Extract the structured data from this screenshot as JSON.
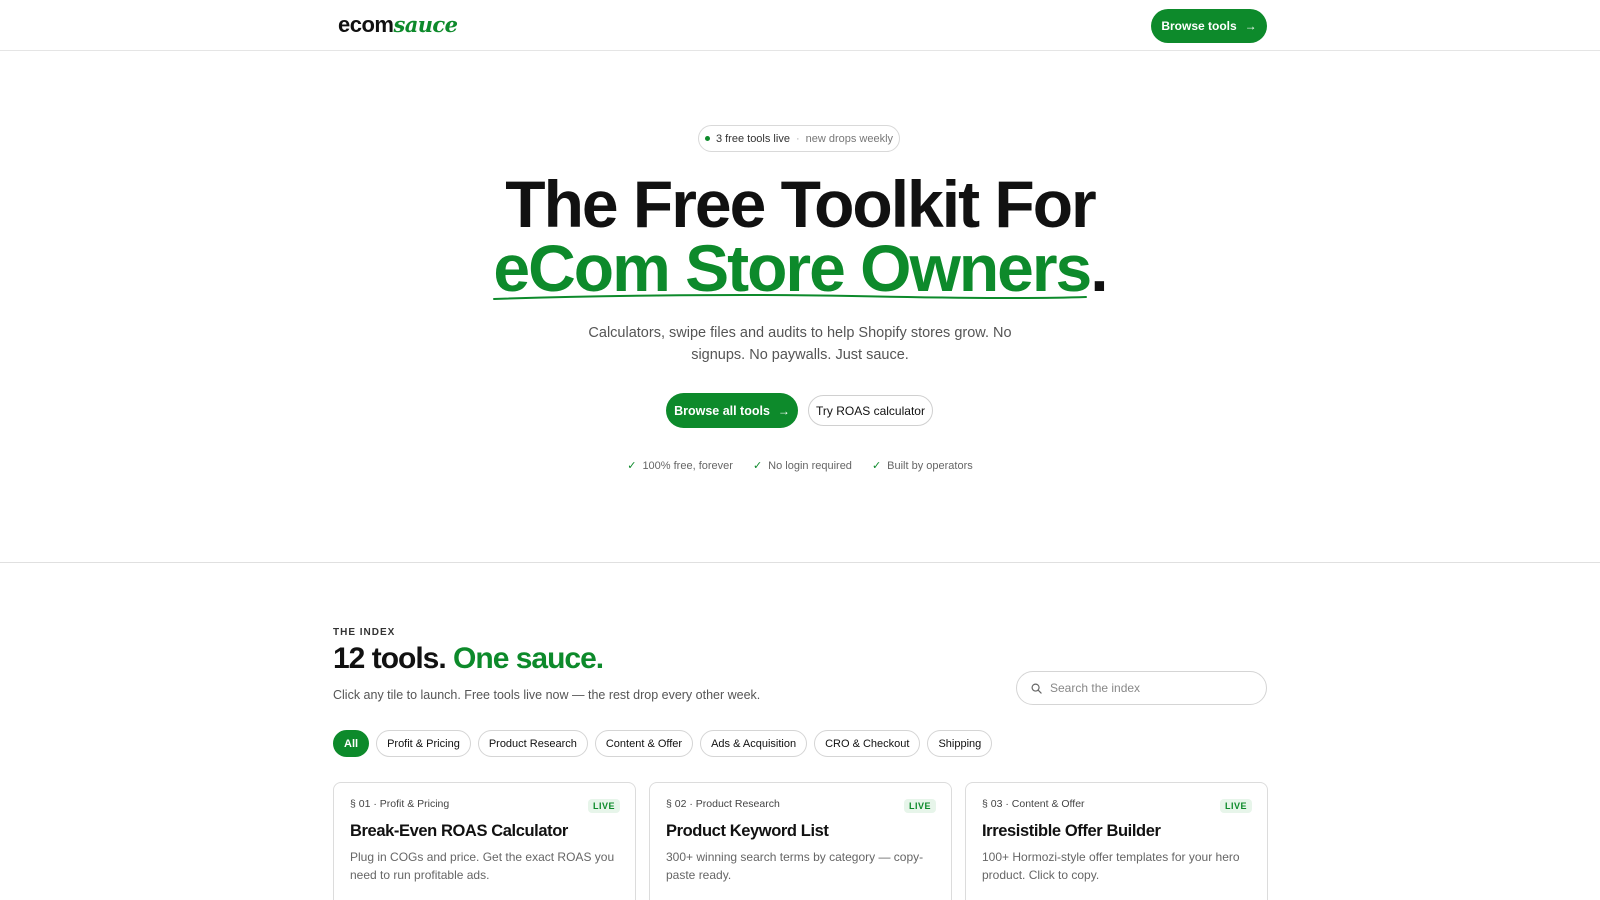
{
  "header": {
    "logo_main": "ecom",
    "logo_script": "sauce",
    "browse_tools_label": "Browse tools",
    "browse_tools_arrow": "→"
  },
  "hero": {
    "pill_live": "3 free tools live",
    "pill_sep": "·",
    "pill_drops": "new drops weekly",
    "title_line1": "The Free Toolkit For",
    "title_line2": "eCom Store Owners",
    "title_period": ".",
    "subtitle": "Calculators, swipe files and audits to help Shopify stores grow. No signups. No paywalls. Just sauce.",
    "primary_cta": "Browse all tools",
    "primary_cta_arrow": "→",
    "secondary_cta": "Try ROAS calculator",
    "checks": [
      "100% free, forever",
      "No login required",
      "Built by operators"
    ]
  },
  "index": {
    "eyebrow": "THE INDEX",
    "title_part1": "12 tools.",
    "title_part2": "One sauce.",
    "description": "Click any tile to launch. Free tools live now — the rest drop every other week.",
    "search_placeholder": "Search the index",
    "filters": [
      "All",
      "Profit & Pricing",
      "Product Research",
      "Content & Offer",
      "Ads & Acquisition",
      "CRO & Checkout",
      "Shipping"
    ],
    "active_filter": "All",
    "cards": [
      {
        "meta": "§ 01 · Profit & Pricing",
        "badge": "LIVE",
        "title": "Break-Even ROAS Calculator",
        "desc": "Plug in COGs and price. Get the exact ROAS you need to run profitable ads."
      },
      {
        "meta": "§ 02 · Product Research",
        "badge": "LIVE",
        "title": "Product Keyword List",
        "desc": "300+ winning search terms by category — copy-paste ready."
      },
      {
        "meta": "§ 03 · Content & Offer",
        "badge": "LIVE",
        "title": "Irresistible Offer Builder",
        "desc": "100+ Hormozi-style offer templates for your hero product. Click to copy."
      }
    ]
  },
  "colors": {
    "brand_green": "#0d8a2b",
    "text": "#111111",
    "muted": "#666666"
  }
}
